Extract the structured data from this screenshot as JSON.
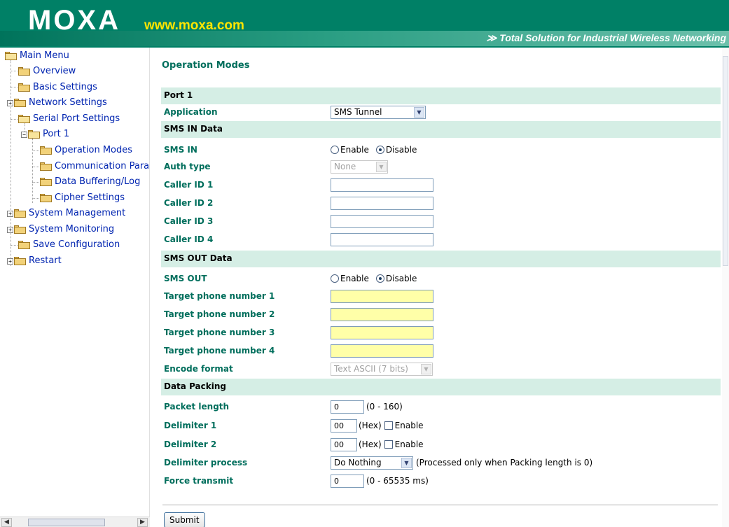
{
  "header": {
    "logo": "MOXA",
    "url": "www.moxa.com",
    "tagline_arrows": "≫",
    "tagline": "Total Solution for Industrial Wireless Networking"
  },
  "sidebar": {
    "items": [
      {
        "label": "Main Menu"
      },
      {
        "label": "Overview"
      },
      {
        "label": "Basic Settings"
      },
      {
        "label": "Network Settings"
      },
      {
        "label": "Serial Port Settings"
      },
      {
        "label": "Port 1"
      },
      {
        "label": "Operation Modes"
      },
      {
        "label": "Communication Para"
      },
      {
        "label": "Data Buffering/Log"
      },
      {
        "label": "Cipher Settings"
      },
      {
        "label": "System Management"
      },
      {
        "label": "System Monitoring"
      },
      {
        "label": "Save Configuration"
      },
      {
        "label": "Restart"
      }
    ]
  },
  "main": {
    "title": "Operation Modes",
    "port_section": "Port 1",
    "application_label": "Application",
    "application_value": "SMS Tunnel",
    "sms_in_section": "SMS IN Data",
    "sms_in_label": "SMS IN",
    "enable_label": "Enable",
    "disable_label": "Disable",
    "auth_type_label": "Auth type",
    "auth_type_value": "None",
    "caller_id_1": "Caller ID 1",
    "caller_id_2": "Caller ID 2",
    "caller_id_3": "Caller ID 3",
    "caller_id_4": "Caller ID 4",
    "sms_out_section": "SMS OUT Data",
    "sms_out_label": "SMS OUT",
    "target_1": "Target phone number 1",
    "target_2": "Target phone number 2",
    "target_3": "Target phone number 3",
    "target_4": "Target phone number 4",
    "encode_label": "Encode format",
    "encode_value": "Text ASCII (7 bits)",
    "packing_section": "Data Packing",
    "packet_length_label": "Packet length",
    "packet_length_value": "0",
    "packet_length_range": "(0 - 160)",
    "delim1_label": "Delimiter 1",
    "delim1_value": "00",
    "delim2_label": "Delimiter 2",
    "delim2_value": "00",
    "hex_label": "(Hex)",
    "delim_enable_label": "Enable",
    "delim_process_label": "Delimiter process",
    "delim_process_value": "Do Nothing",
    "delim_process_note": "(Processed only when Packing length is 0)",
    "force_transmit_label": "Force transmit",
    "force_transmit_value": "0",
    "force_transmit_range": "(0 - 65535 ms)",
    "submit_label": "Submit"
  }
}
